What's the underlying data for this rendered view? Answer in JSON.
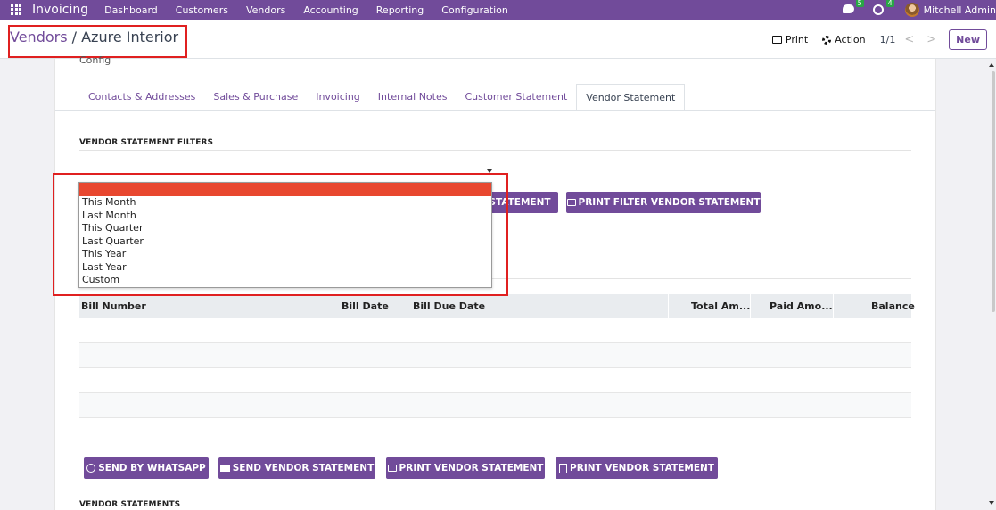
{
  "navbar": {
    "brand": "Invoicing",
    "menu": [
      "Dashboard",
      "Customers",
      "Vendors",
      "Accounting",
      "Reporting",
      "Configuration"
    ],
    "messages_count": "5",
    "activities_count": "4",
    "user": "Mitchell Admin",
    "color": "#714b9a"
  },
  "breadcrumb": {
    "parent": "Vendors",
    "separator": " / ",
    "current": "Azure Interior"
  },
  "control": {
    "print": "Print",
    "action": "Action",
    "pager": "1/1",
    "prev": "<",
    "next": ">",
    "new": "New"
  },
  "sheet": {
    "cut_label": "Config",
    "tabs": [
      "Contacts & Addresses",
      "Sales & Purchase",
      "Invoicing",
      "Internal Notes",
      "Customer Statement",
      "Vendor Statement"
    ],
    "active_tab": "Vendor Statement",
    "filters_title": "VENDOR STATEMENT FILTERS",
    "filter_send_button": "STATEMENT",
    "filter_print_button": "PRINT FILTER VENDOR STATEMENT",
    "table_headers": [
      "Bill Number",
      "Bill Date",
      "Bill Due Date",
      "Total Am...",
      "Paid Amo...",
      "Balance"
    ],
    "buttons": {
      "whatsapp": "SEND BY WHATSAPP",
      "send": "SEND VENDOR STATEMENT",
      "print": "PRINT VENDOR STATEMENT",
      "print_pdf": "PRINT VENDOR STATEMENT"
    },
    "statements_title": "VENDOR STATEMENTS"
  },
  "dropdown": {
    "selected": "",
    "options": [
      "This Month",
      "Last Month",
      "This Quarter",
      "Last Quarter",
      "This Year",
      "Last Year",
      "Custom"
    ],
    "selected_color": "#e8472f"
  },
  "annotation_color": "#e02020"
}
